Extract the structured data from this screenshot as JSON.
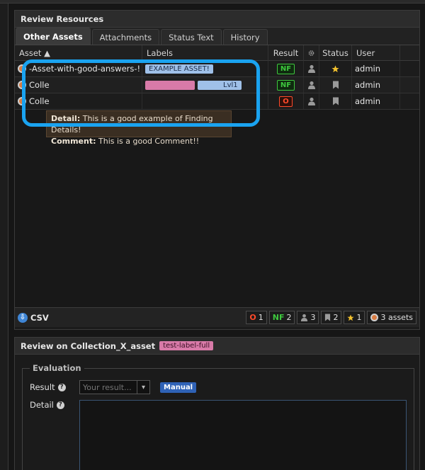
{
  "resources_panel": {
    "title": "Review Resources",
    "tabs": [
      {
        "label": "Other Assets",
        "active": true
      },
      {
        "label": "Attachments",
        "active": false
      },
      {
        "label": "Status Text",
        "active": false
      },
      {
        "label": "History",
        "active": false
      }
    ],
    "columns": {
      "asset": "Asset ▲",
      "labels": "Labels",
      "result": "Result",
      "status": "Status",
      "user": "User"
    },
    "rows": [
      {
        "asset": "-Asset-with-good-answers-!",
        "labels": [
          "EXAMPLE ASSET!"
        ],
        "result": "NF",
        "status": "star",
        "user": "admin"
      },
      {
        "asset": "Colle",
        "labels": [
          "",
          "Lvl1"
        ],
        "result": "NF",
        "status": "bookmark",
        "user": "admin"
      },
      {
        "asset": "Colle",
        "labels": [],
        "result": "O",
        "status": "bookmark",
        "user": "admin"
      }
    ],
    "tooltip": {
      "detail_label": "Detail:",
      "detail_text": "This is a good example of Finding Details!",
      "comment_label": "Comment:",
      "comment_text": "This is a good Comment!!"
    },
    "footer": {
      "csv_label": "CSV",
      "open_count": "1",
      "open_label": "O",
      "nf_count": "2",
      "nf_label": "NF",
      "user_count": "3",
      "saved_count": "2",
      "star_count": "1",
      "assets_label": "3 assets"
    }
  },
  "review_panel": {
    "title": "Review on Collection_X_asset",
    "tag": "test-label-full",
    "evaluation": {
      "legend": "Evaluation",
      "result_label": "Result",
      "result_placeholder": "Your result...",
      "manual_badge": "Manual",
      "detail_label": "Detail",
      "detail_value": ""
    }
  },
  "colors": {
    "highlight": "#1aa3f0",
    "nf": "#3ec83e",
    "open": "#ff4a2a",
    "label_blue": "#9fc0e8",
    "label_pink": "#d87aa8",
    "manual": "#2f62b6"
  }
}
